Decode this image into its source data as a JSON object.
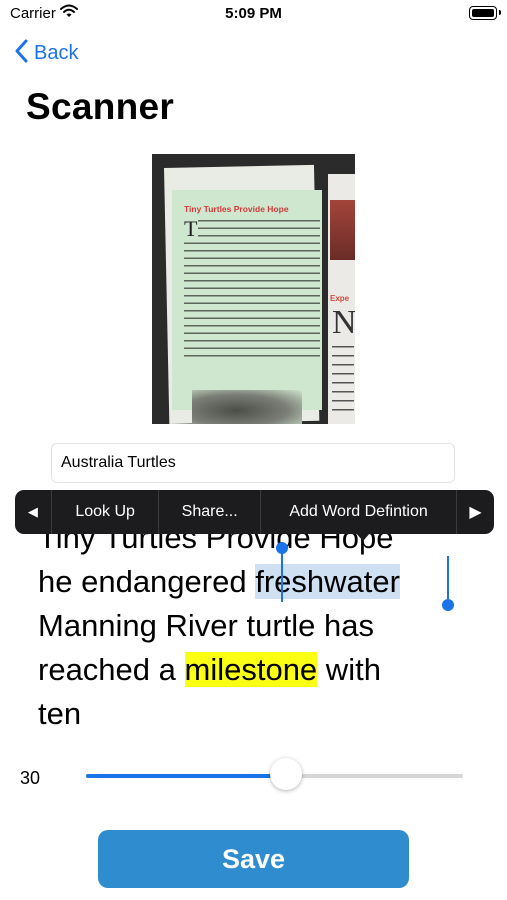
{
  "status_bar": {
    "carrier": "Carrier",
    "time": "5:09 PM",
    "icons": [
      "wifi-icon",
      "battery-icon"
    ]
  },
  "nav": {
    "back_label": "Back",
    "back_icon": "chevron-left-icon"
  },
  "title": "Scanner",
  "scan_image": {
    "headline": "Tiny Turtles Provide Hope",
    "drop_cap": "T",
    "right_heading": "Expe",
    "right_letter": "N"
  },
  "title_field": {
    "value": "Australia Turtles",
    "placeholder": ""
  },
  "edit_menu": {
    "prev_arrow": "◀",
    "items": [
      "Look Up",
      "Share...",
      "Add Word Defintion"
    ],
    "next_arrow": "▶"
  },
  "text_view": {
    "line1": "Tiny Turtles Provide Hope",
    "line2_before": "he endangered ",
    "line2_selected": "freshwater",
    "line3": "Manning River turtle has",
    "line4_before": "reached a ",
    "line4_highlight": "milestone",
    "line4_after": " with",
    "line5": "ten"
  },
  "slider": {
    "value_label": "30",
    "fraction": 0.53
  },
  "colors": {
    "accent": "#1a73e8",
    "selection": "#cfe0f3",
    "highlight": "#fbff14",
    "save_button": "#2e8ccf",
    "menu_background": "#1c1c1e"
  },
  "save_label": "Save"
}
